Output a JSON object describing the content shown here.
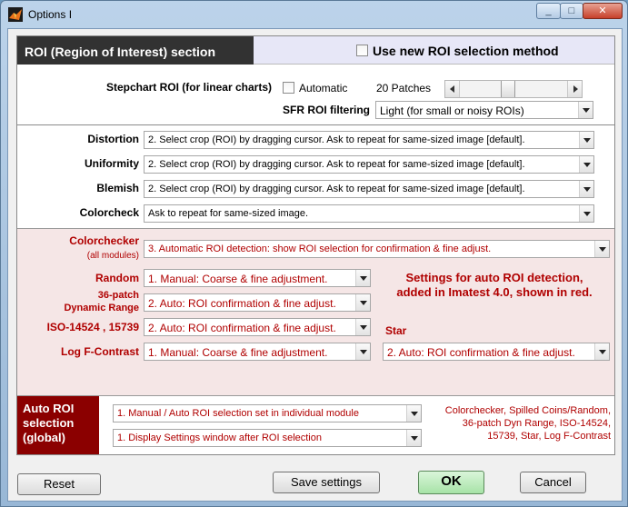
{
  "window": {
    "title": "Options I"
  },
  "header": {
    "title": "ROI (Region of Interest) section",
    "new_roi_label": "Use new ROI selection method",
    "new_roi_checked": false
  },
  "stepchart": {
    "label": "Stepchart ROI (for linear charts)",
    "automatic_label": "Automatic",
    "automatic_checked": false,
    "patches_label": "20 Patches",
    "patches_value": 20,
    "sfr_label": "SFR ROI filtering",
    "sfr_value": "Light    (for small or noisy ROIs)"
  },
  "modules": [
    {
      "label": "Distortion",
      "value": "2. Select crop (ROI) by dragging cursor. Ask to repeat for same-sized image [default]."
    },
    {
      "label": "Uniformity",
      "value": "2. Select crop (ROI) by dragging cursor. Ask to repeat for same-sized image [default]."
    },
    {
      "label": "Blemish",
      "value": "2. Select crop (ROI) by dragging cursor. Ask to repeat for same-sized image [default]."
    },
    {
      "label": "Colorcheck",
      "value": "Ask to repeat for same-sized image."
    }
  ],
  "auto_modules": {
    "colorchecker": {
      "label": "Colorchecker",
      "sublabel": "(all modules)",
      "value": "3. Automatic ROI detection: show ROI selection for confirmation & fine adjust."
    },
    "random": {
      "label": "Random",
      "value": "1. Manual:  Coarse & fine adjustment."
    },
    "dynamic_range": {
      "label_line1": "36-patch",
      "label_line2": "Dynamic Range",
      "value": "2. Auto:  ROI confirmation & fine adjust."
    },
    "iso": {
      "label": "ISO-14524 , 15739",
      "value": "2. Auto:  ROI confirmation & fine adjust."
    },
    "log_f": {
      "label": "Log F-Contrast",
      "value": "1. Manual:  Coarse & fine adjustment."
    },
    "star": {
      "label": "Star",
      "value": "2. Auto:  ROI confirmation & fine adjust."
    },
    "note_line1": "Settings for auto ROI detection,",
    "note_line2": "added in Imatest 4.0, shown in red."
  },
  "auto_roi": {
    "label_line1": "Auto ROI",
    "label_line2": "selection",
    "label_line3": "(global)",
    "mode_value": "1. Manual / Auto ROI selection set in individual module",
    "display_value": "1. Display Settings window after  ROI selection",
    "note_line1": "Colorchecker, Spilled Coins/Random,",
    "note_line2": "36-patch Dyn Range, ISO-14524,",
    "note_line3": "15739, Star, Log F-Contrast"
  },
  "buttons": {
    "reset": "Reset",
    "save": "Save settings",
    "ok": "OK",
    "cancel": "Cancel"
  },
  "colors": {
    "accent_red": "#b00000",
    "auto_header": "#8b0000",
    "red_section_bg": "#f5e6e6",
    "header_dark": "#323232",
    "ok_green": "#a7e3a7"
  }
}
